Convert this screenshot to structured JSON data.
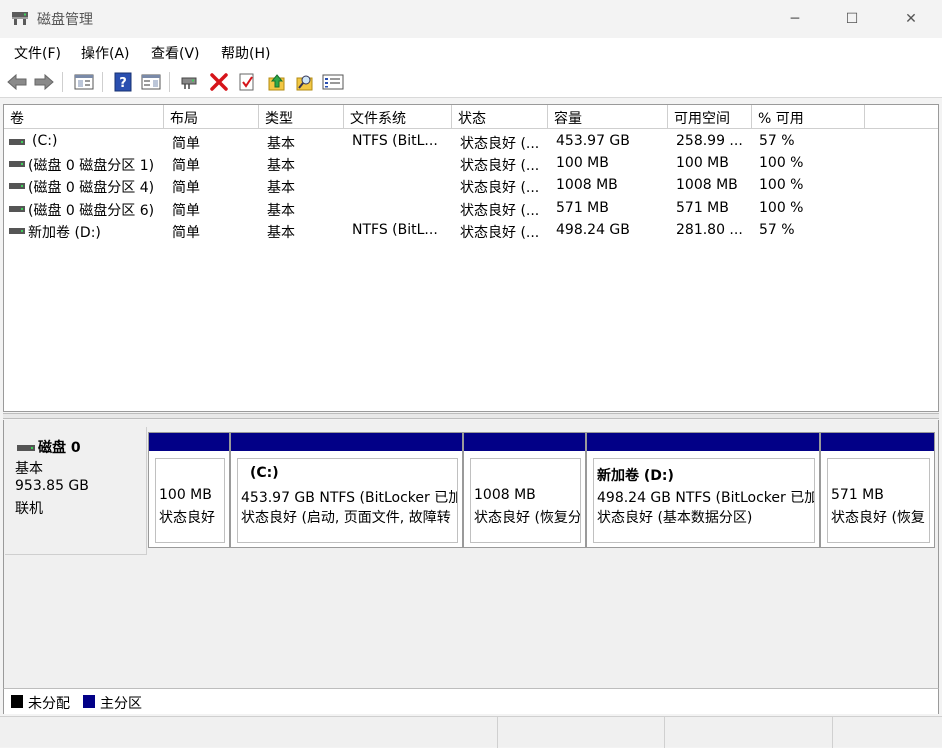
{
  "window": {
    "title": "磁盘管理",
    "minimize": "─",
    "maximize": "☐",
    "close": "✕"
  },
  "menu": [
    "文件(F)",
    "操作(A)",
    "查看(V)",
    "帮助(H)"
  ],
  "columns": [
    "卷",
    "布局",
    "类型",
    "文件系统",
    "状态",
    "容量",
    "可用空间",
    "% 可用"
  ],
  "volumes": [
    {
      "name": "(C:)",
      "layout": "简单",
      "type": "基本",
      "fs": "NTFS (BitL...",
      "status": "状态良好 (...",
      "capacity": "453.97 GB",
      "free": "258.99 ...",
      "pct": "57 %"
    },
    {
      "name": "(磁盘 0 磁盘分区 1)",
      "layout": "简单",
      "type": "基本",
      "fs": "",
      "status": "状态良好 (...",
      "capacity": "100 MB",
      "free": "100 MB",
      "pct": "100 %"
    },
    {
      "name": "(磁盘 0 磁盘分区 4)",
      "layout": "简单",
      "type": "基本",
      "fs": "",
      "status": "状态良好 (...",
      "capacity": "1008 MB",
      "free": "1008 MB",
      "pct": "100 %"
    },
    {
      "name": "(磁盘 0 磁盘分区 6)",
      "layout": "简单",
      "type": "基本",
      "fs": "",
      "status": "状态良好 (...",
      "capacity": "571 MB",
      "free": "571 MB",
      "pct": "100 %"
    },
    {
      "name": "新加卷 (D:)",
      "layout": "简单",
      "type": "基本",
      "fs": "NTFS (BitL...",
      "status": "状态良好 (...",
      "capacity": "498.24 GB",
      "free": "281.80 ...",
      "pct": "57 %"
    }
  ],
  "disk": {
    "name": "磁盘 0",
    "type": "基本",
    "size": "953.85 GB",
    "state": "联机"
  },
  "partitions": [
    {
      "title": "",
      "line1": "100 MB",
      "line2": "状态良好"
    },
    {
      "title": "(C:)",
      "line1": "453.97 GB NTFS (BitLocker 已加",
      "line2": "状态良好 (启动, 页面文件, 故障转"
    },
    {
      "title": "",
      "line1": "1008 MB",
      "line2": "状态良好 (恢复分"
    },
    {
      "title": "新加卷  (D:)",
      "line1": "498.24 GB NTFS (BitLocker 已加",
      "line2": "状态良好 (基本数据分区)"
    },
    {
      "title": "",
      "line1": "571 MB",
      "line2": "状态良好 (恢复"
    }
  ],
  "legend": [
    {
      "label": "未分配",
      "color": "#000000"
    },
    {
      "label": "主分区",
      "color": "#020087"
    }
  ],
  "icons": [
    "back-arrow-icon",
    "forward-arrow-icon",
    "properties-pane-icon",
    "help-icon",
    "show-pane-icon",
    "connect-drive-icon",
    "delete-icon",
    "check-icon",
    "export-up-icon",
    "search-icon",
    "settings-list-icon"
  ]
}
